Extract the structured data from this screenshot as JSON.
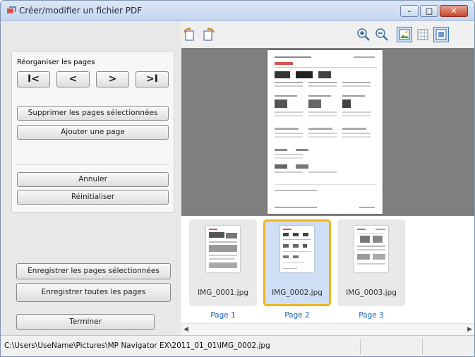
{
  "window": {
    "title": "Créer/modifier un fichier PDF",
    "minimize": "–",
    "maximize": "□",
    "close": "✕"
  },
  "toolbar": {
    "icons": [
      "rotate-left-icon",
      "rotate-right-icon",
      "zoom-in-icon",
      "zoom-out-icon",
      "preview-view-icon",
      "thumbnail-view-icon",
      "full-screen-icon"
    ]
  },
  "left": {
    "reorder_label": "Réorganiser les pages",
    "nav": {
      "first": "I<",
      "prev": "<",
      "next": ">",
      "last": ">I"
    },
    "delete_selected": "Supprimer les pages sélectionnées",
    "add_page": "Ajouter une page",
    "undo": "Annuler",
    "reset": "Réinitialiser",
    "save_selected": "Enregistrer les pages sélectionnées",
    "save_all": "Enregistrer toutes les pages",
    "finish": "Terminer"
  },
  "thumbnails": [
    {
      "name": "IMG_0001.jpg",
      "page": "Page 1",
      "selected": false
    },
    {
      "name": "IMG_0002.jpg",
      "page": "Page 2",
      "selected": true
    },
    {
      "name": "IMG_0003.jpg",
      "page": "Page 3",
      "selected": false
    }
  ],
  "scroll": {
    "left": "◀",
    "right": "▶"
  },
  "status": {
    "path": "C:\\Users\\UseName\\Pictures\\MP Navigator EX\\2011_01_01\\IMG_0002.jpg"
  },
  "colors": {
    "selection_border": "#f0b51b",
    "page_label": "#1662c5"
  }
}
